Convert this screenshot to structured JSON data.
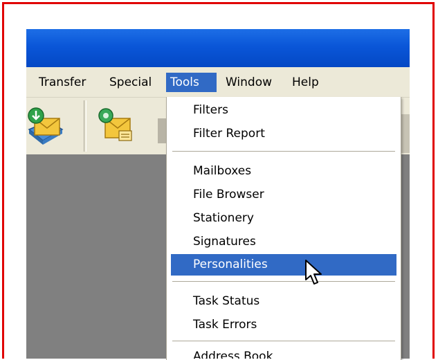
{
  "menubar": {
    "items": [
      {
        "label": "Transfer",
        "active": false
      },
      {
        "label": "Special",
        "active": false
      },
      {
        "label": "Tools",
        "active": true
      },
      {
        "label": "Window",
        "active": false
      },
      {
        "label": "Help",
        "active": false
      }
    ]
  },
  "toolbar": {
    "icons": [
      "check-mail-icon",
      "new-message-icon"
    ]
  },
  "tools_menu": {
    "items": [
      {
        "label": "Filters"
      },
      {
        "label": "Filter Report"
      },
      {
        "label": "Mailboxes"
      },
      {
        "label": "File Browser"
      },
      {
        "label": "Stationery"
      },
      {
        "label": "Signatures"
      },
      {
        "label": "Personalities",
        "highlighted": true
      },
      {
        "label": "Task Status"
      },
      {
        "label": "Task Errors"
      },
      {
        "label": "Address Book"
      }
    ]
  },
  "colors": {
    "frame": "#e00000",
    "titlebar": "#0a56d8",
    "menubar": "#ece9d8",
    "highlight": "#316ac5",
    "content": "#808080"
  }
}
